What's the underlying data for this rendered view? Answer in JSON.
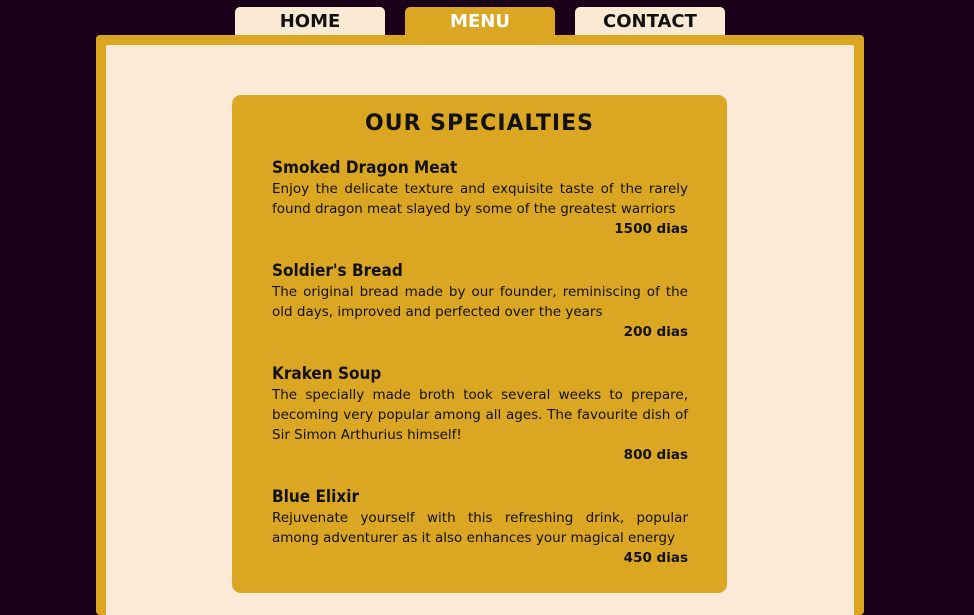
{
  "nav": {
    "tabs": [
      {
        "label": "HOME",
        "active": false
      },
      {
        "label": "MENU",
        "active": true
      },
      {
        "label": "CONTACT",
        "active": false
      }
    ]
  },
  "colors": {
    "background": "#1a0018",
    "accent": "#dba722",
    "cream": "#fbead7",
    "active_tab_text": "#ffffff"
  },
  "specialties": {
    "title": "OUR SPECIALTIES",
    "items": [
      {
        "name": "Smoked Dragon Meat",
        "description": "Enjoy the delicate texture and exquisite taste of the rarely found dragon meat slayed by some of the greatest warriors",
        "price": "1500 dias"
      },
      {
        "name": "Soldier's Bread",
        "description": "The original bread made by our founder, reminiscing of the old days, improved and perfected over the years",
        "price": "200 dias"
      },
      {
        "name": "Kraken Soup",
        "description": "The specially made broth took several weeks to prepare, becoming very popular among all ages. The favourite dish of Sir Simon Arthurius himself!",
        "price": "800 dias"
      },
      {
        "name": "Blue Elixir",
        "description": "Rejuvenate yourself with this refreshing drink, popular among adventurer as it also enhances your magical energy",
        "price": "450 dias"
      }
    ]
  }
}
